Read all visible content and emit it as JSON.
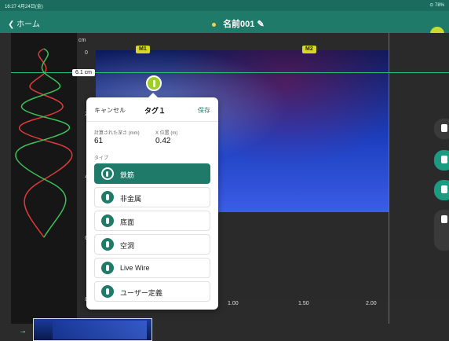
{
  "statusbar": {
    "time": "16:27 4月24日(金)",
    "battery": "⊙ 78%"
  },
  "nav": {
    "back_label": "ホーム",
    "title": "名前001",
    "edit_icon": "pencil-icon"
  },
  "axis": {
    "unit": "cm",
    "y_ticks": [
      "0",
      "2",
      "4",
      "6",
      "8"
    ],
    "x_ticks": [
      "1.00",
      "1.50",
      "2.00"
    ],
    "cursor_depth": "6.1 cm",
    "markers": [
      "M1",
      "M2"
    ]
  },
  "popup": {
    "cancel": "キャンセル",
    "title": "タグ１",
    "save": "保存",
    "depth_label": "計算された深さ (mm)",
    "depth_value": "61",
    "xpos_label": "X 位置 (m)",
    "xpos_value": "0.42",
    "type_label": "タイプ",
    "options": [
      {
        "label": "鉄筋",
        "icon": "rebar-icon",
        "selected": true
      },
      {
        "label": "非金属",
        "icon": "nonmetal-icon",
        "selected": false
      },
      {
        "label": "底面",
        "icon": "bottom-icon",
        "selected": false
      },
      {
        "label": "空洞",
        "icon": "void-icon",
        "selected": false
      },
      {
        "label": "Live Wire",
        "icon": "live-wire-icon",
        "selected": false
      },
      {
        "label": "ユーザー定義",
        "icon": "user-defined-icon",
        "selected": false
      }
    ]
  },
  "right_tools": [
    "trash-icon",
    "pause-icon",
    "stop-icon",
    "split-icon"
  ]
}
